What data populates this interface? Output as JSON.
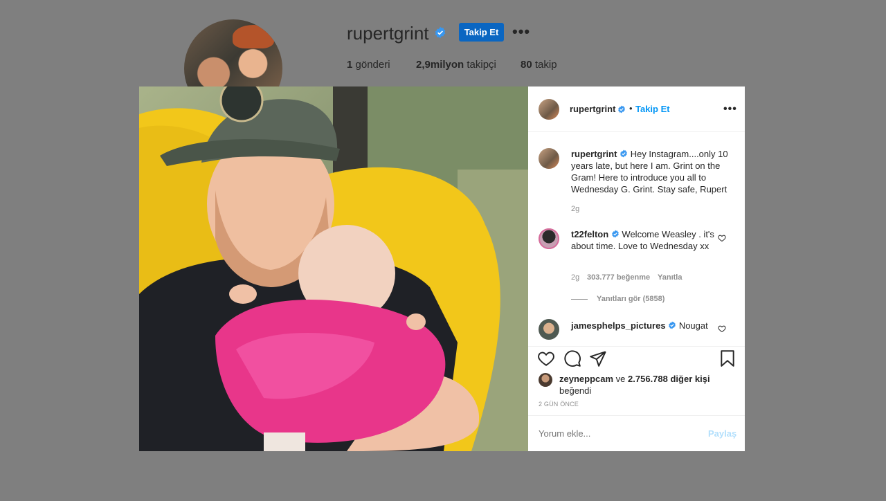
{
  "profile": {
    "username": "rupertgrint",
    "follow_label": "Takip Et",
    "more_label": "•••",
    "stats": [
      {
        "count": "1",
        "label": "gönderi"
      },
      {
        "count": "2,9milyon",
        "label": "takipçi"
      },
      {
        "count": "80",
        "label": "takip"
      }
    ]
  },
  "post": {
    "username": "rupertgrint",
    "dot": "•",
    "follow_label": "Takip Et",
    "more_label": "•••",
    "caption": {
      "username": "rupertgrint",
      "text": "Hey Instagram....only 10 years late, but here I am. Grint on the Gram! Here to introduce you all to Wednesday G. Grint. Stay safe, Rupert",
      "time": "2g"
    },
    "comments": [
      {
        "username": "t22felton",
        "text": "Welcome Weasley . it's about time. Love to Wednesday xx",
        "time": "2g",
        "likes": "303.777 beğenme",
        "reply_label": "Yanıtla",
        "view_replies": "Yanıtları gör (5858)"
      },
      {
        "username": "jamesphelps_pictures",
        "text": "Nougat"
      }
    ],
    "liked_by": {
      "user": "zeyneppcam",
      "connector": "ve",
      "others": "2.756.788 diğer kişi",
      "suffix": "beğendi"
    },
    "time_ago": "2 GÜN ÖNCE",
    "comment_placeholder": "Yorum ekle...",
    "share_label": "Paylaş"
  },
  "colors": {
    "background": "#7f7f7f",
    "follow_button": "#0a66c2",
    "link_blue": "#0095f6",
    "verified_blue": "#3897f0",
    "share_disabled": "#b2dffc"
  },
  "icons": [
    "verified-badge-icon",
    "heart-icon",
    "comment-icon",
    "share-icon",
    "bookmark-icon",
    "more-options-icon"
  ]
}
